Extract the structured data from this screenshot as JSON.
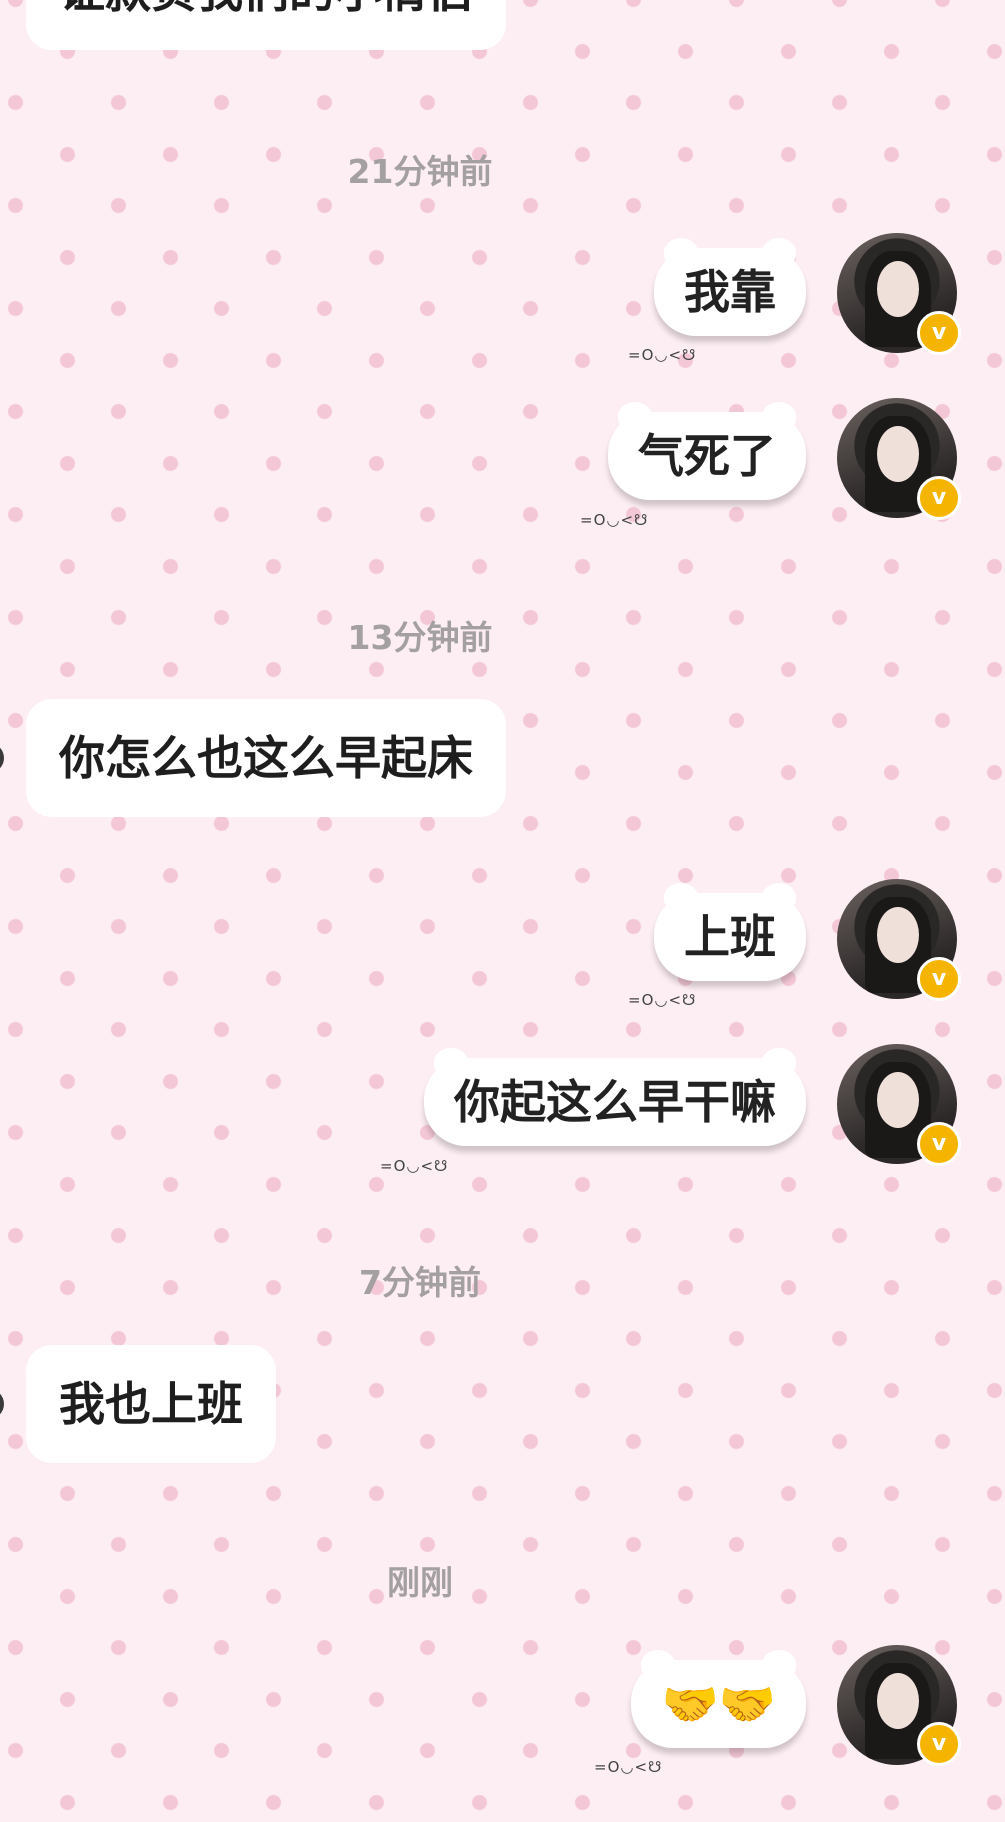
{
  "messages": {
    "top_partial": "证款负我们的小情侣",
    "ts1": "21分钟前",
    "r1": "我靠",
    "r2": "气死了",
    "ts2": "13分钟前",
    "l1": "你怎么也这么早起床",
    "r3": "上班",
    "r4": "你起这么早干嘛",
    "ts3": "7分钟前",
    "l2": "我也上班",
    "ts4": "刚刚",
    "r5": "🤝🤝"
  },
  "decoration": "=O◡<☋",
  "badge_icon": "v-verified-icon",
  "colors": {
    "background": "#fdeef3",
    "dots": "#f4c7d7",
    "badge": "#f4b400"
  }
}
